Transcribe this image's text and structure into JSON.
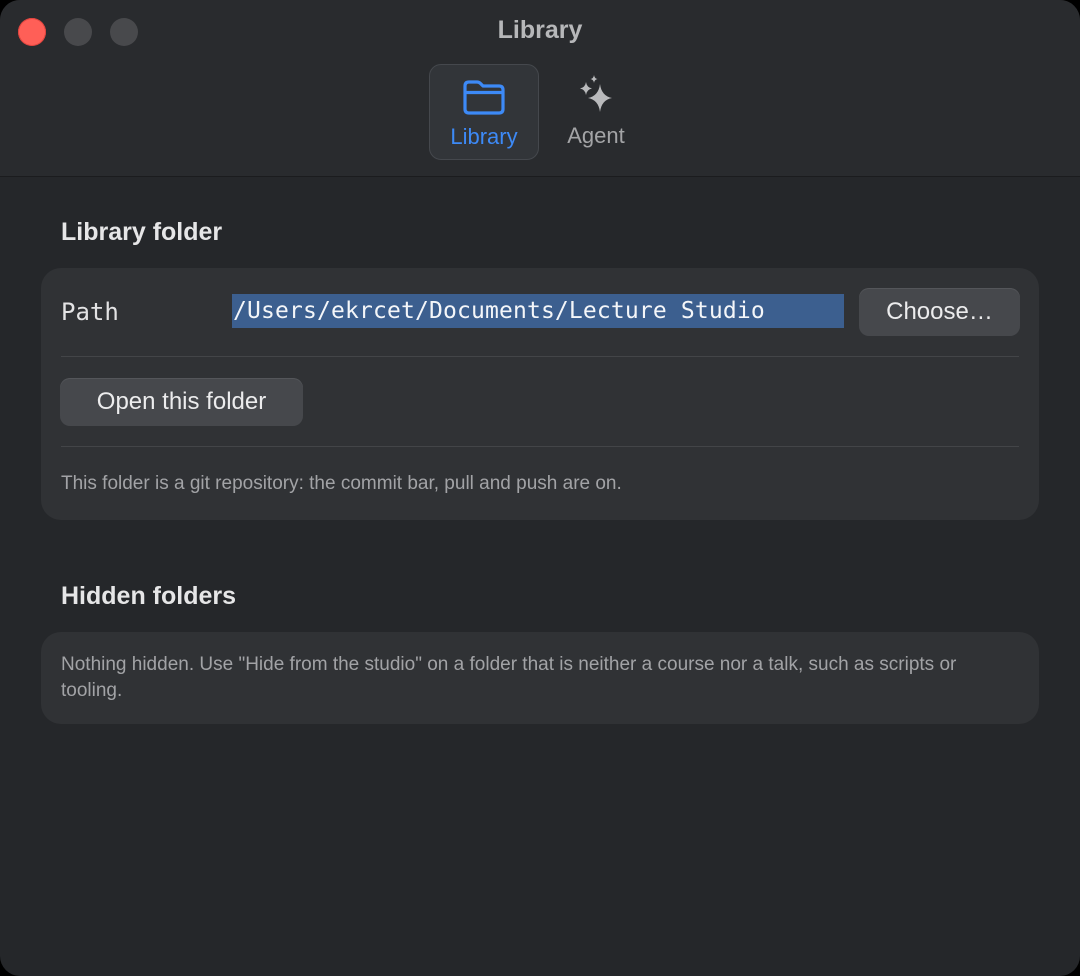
{
  "window": {
    "title": "Library"
  },
  "toolbar": {
    "tabs": [
      {
        "label": "Library",
        "icon": "folder-icon",
        "selected": true,
        "accent": "#3d8af7"
      },
      {
        "label": "Agent",
        "icon": "sparkles-icon",
        "selected": false
      }
    ]
  },
  "library_folder": {
    "heading": "Library folder",
    "path_label": "Path",
    "path_value": "/Users/ekrcet/Documents/Lecture Studio",
    "choose_button": "Choose…",
    "open_button": "Open this folder",
    "git_note": "This folder is a git repository: the commit bar, pull and push are on."
  },
  "hidden_folders": {
    "heading": "Hidden folders",
    "note": "Nothing hidden. Use \"Hide from the studio\" on a folder that is neither a course nor a talk, such as scripts or tooling."
  },
  "colors": {
    "accent": "#3d8af7",
    "close": "#ff5f57",
    "selection": "#3c5f8f"
  }
}
